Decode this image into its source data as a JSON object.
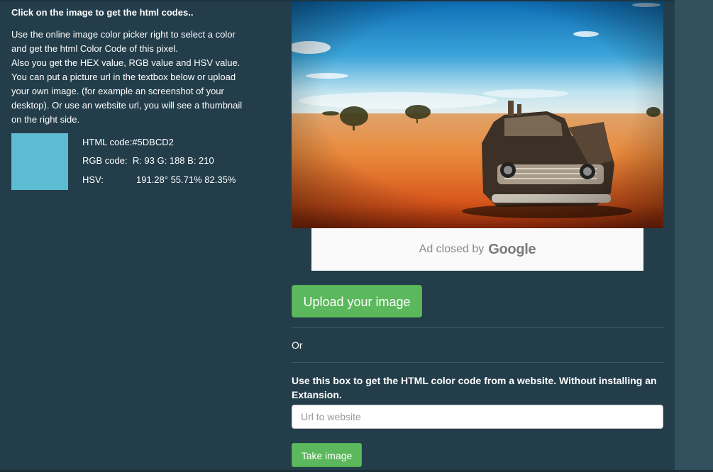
{
  "intro": {
    "title": "Click on the image to get the html codes..",
    "lines": [
      "Use the online image color picker right to select a color",
      "and get the html Color Code of this pixel.",
      "Also you get the HEX value, RGB value and HSV value.",
      "You can put a picture url in the textbox below or upload",
      "your own image. (for example an screenshot of your",
      "desktop). Or use an website url, you will see a thumbnail",
      "on the right side."
    ]
  },
  "picked": {
    "swatch_color": "#5DBCD2",
    "html_label": "HTML code:",
    "html_value": "#5DBCD2",
    "rgb_label": "RGB code:",
    "rgb_value": "R: 93 G: 188 B: 210",
    "hsv_label": "HSV:",
    "hsv_value": "191.28° 55.71% 82.35%"
  },
  "ad": {
    "text": "Ad closed by",
    "brand": "Google"
  },
  "upload": {
    "button_label": "Upload your image"
  },
  "or_text": "Or",
  "website": {
    "label": "Use this box to get the HTML color code from a website. Without installing an Extansion.",
    "placeholder": "Url to website",
    "value": "",
    "button_label": "Take image"
  },
  "colors": {
    "page_background": "#233d4a",
    "button_green": "#5cb85c"
  }
}
